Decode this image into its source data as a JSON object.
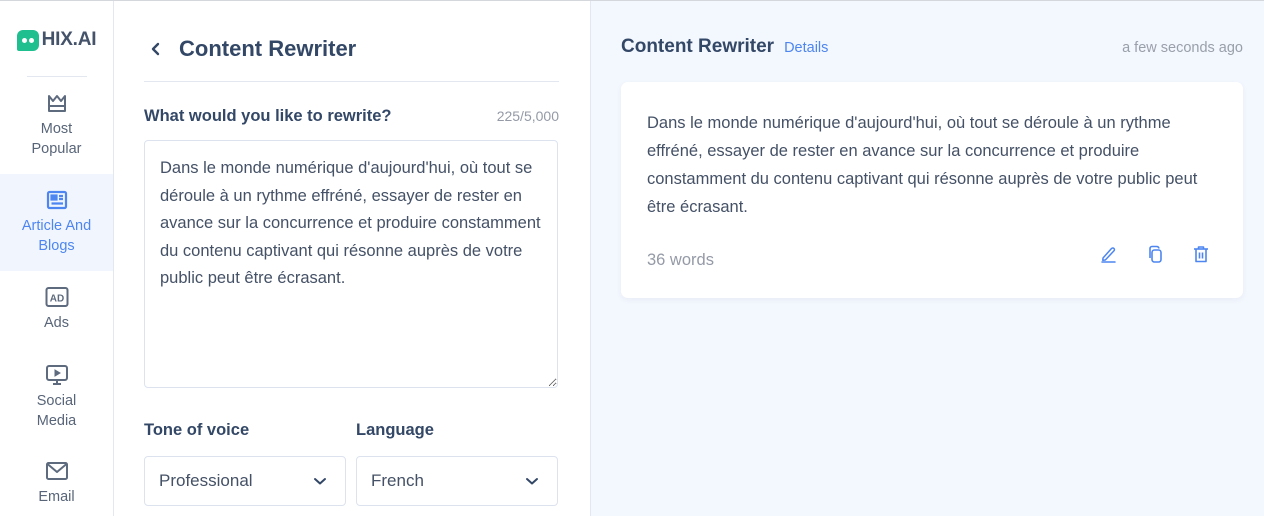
{
  "brand": {
    "name": "HIX.AI",
    "logo_icon": "chat-bubble-logo-icon",
    "color": "#1fbf8f"
  },
  "sidebar": {
    "items": [
      {
        "label": "Most Popular",
        "icon": "crown-icon",
        "active": false
      },
      {
        "label": "Article And Blogs",
        "icon": "newspaper-icon",
        "active": true
      },
      {
        "label": "Ads",
        "icon": "ad-icon",
        "active": false
      },
      {
        "label": "Social Media",
        "icon": "monitor-play-icon",
        "active": false
      },
      {
        "label": "Email",
        "icon": "envelope-icon",
        "active": false
      }
    ]
  },
  "form": {
    "back_icon": "chevron-left-icon",
    "title": "Content Rewriter",
    "input_label": "What would you like to rewrite?",
    "char_count": "225/5,000",
    "input_value": "Dans le monde numérique d'aujourd'hui, où tout se déroule à un rythme effréné, essayer de rester en avance sur la concurrence et produire constamment du contenu captivant qui résonne auprès de votre public peut être écrasant.",
    "tone": {
      "label": "Tone of voice",
      "value": "Professional"
    },
    "language": {
      "label": "Language",
      "value": "French"
    }
  },
  "output": {
    "title": "Content Rewriter",
    "details_label": "Details",
    "timestamp": "a few seconds ago",
    "result_text": "Dans le monde numérique d'aujourd'hui, où tout se déroule à un rythme effréné, essayer de rester en avance sur la concurrence et produire constamment du contenu captivant qui résonne auprès de votre public peut être écrasant.",
    "word_count": "36 words",
    "actions": [
      "edit",
      "copy",
      "delete"
    ]
  },
  "colors": {
    "accent": "#4d86f0",
    "text": "#334766",
    "muted": "#949aa6",
    "panel_bg": "#f3f7fe"
  }
}
